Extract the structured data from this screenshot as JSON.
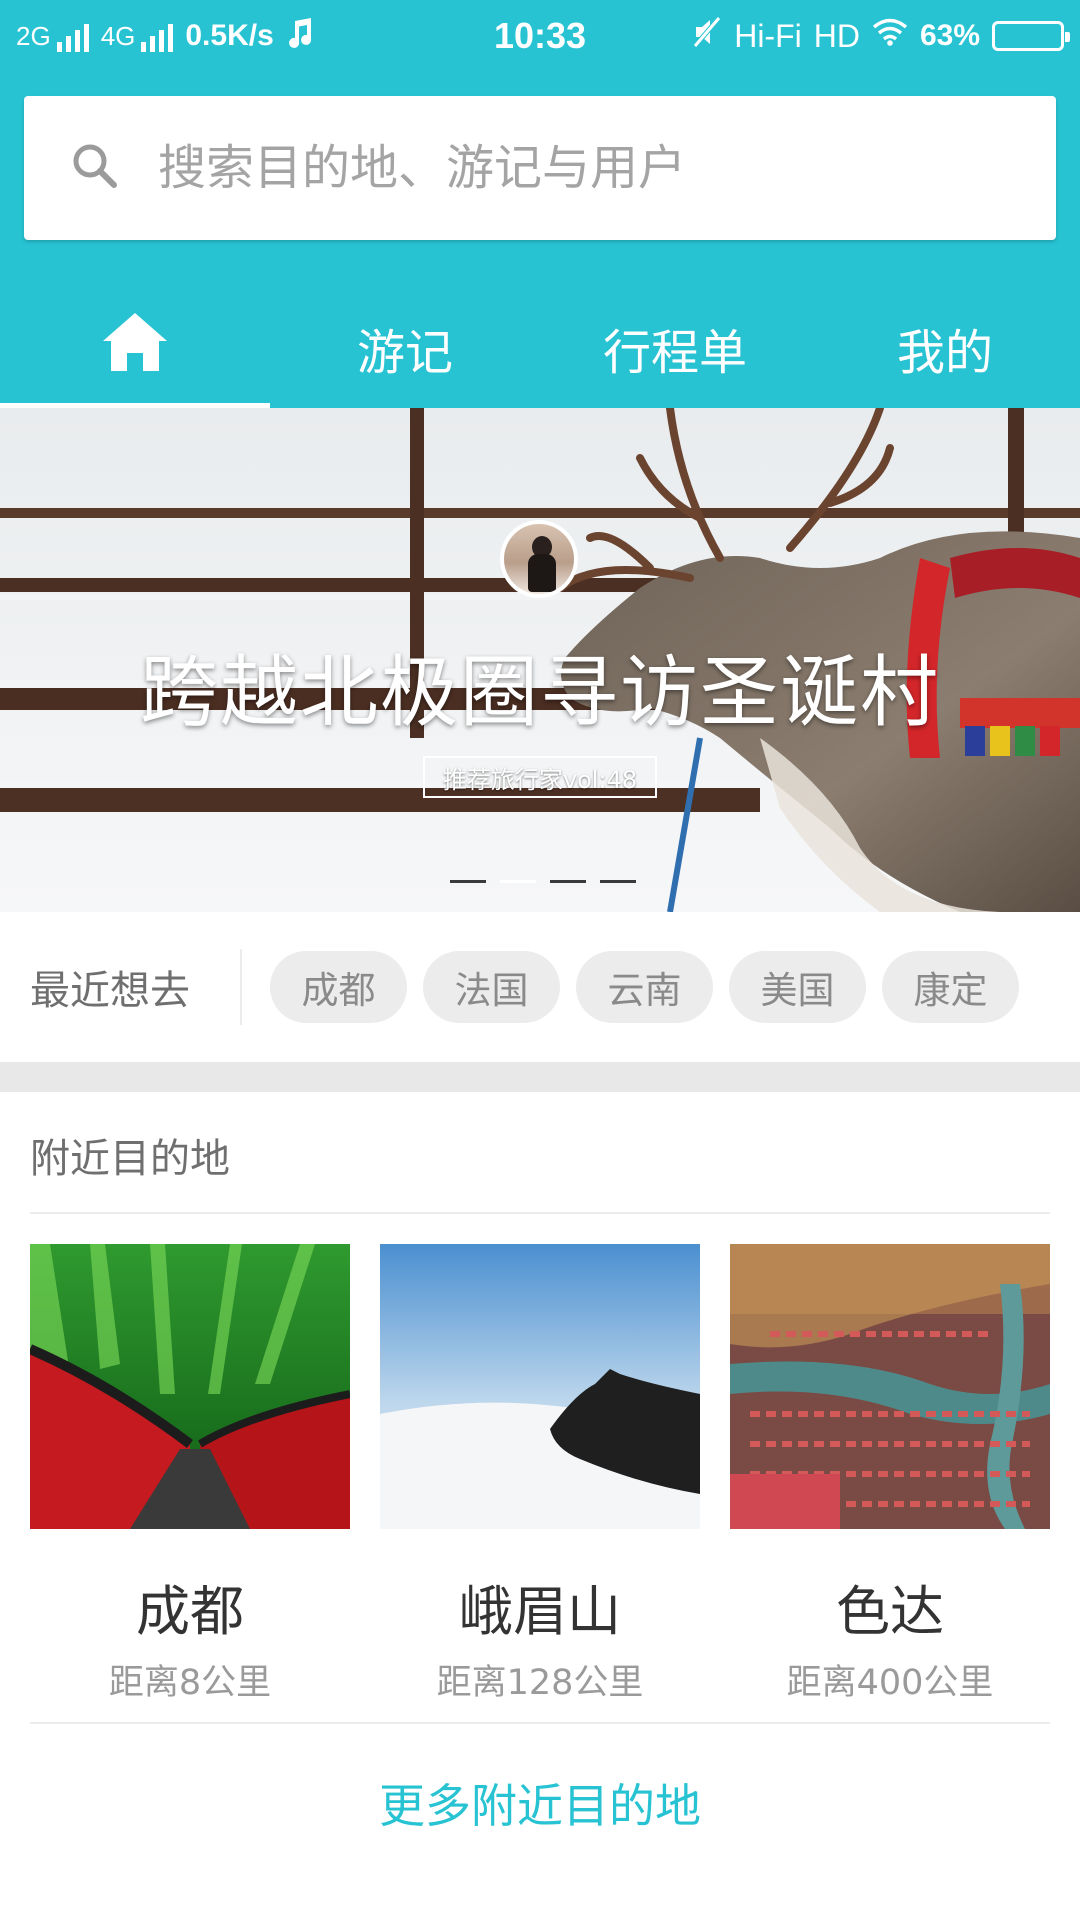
{
  "status_bar": {
    "network1": "2G",
    "network2": "4G",
    "speed": "0.5K/s",
    "time": "10:33",
    "hifi": "Hi-Fi",
    "hd": "HD",
    "battery_text": "63%",
    "battery_level": 0.63
  },
  "search": {
    "placeholder": "搜索目的地、游记与用户"
  },
  "tabs": {
    "home_icon": "home-icon",
    "travelogue": "游记",
    "itinerary": "行程单",
    "mine": "我的"
  },
  "hero": {
    "title": "跨越北极圈寻访圣诞村",
    "subtitle": "推荐旅行家vol:48",
    "page_count": 4,
    "active_page": 1
  },
  "recent": {
    "label": "最近想去",
    "chips": [
      "成都",
      "法国",
      "云南",
      "美国",
      "康定"
    ]
  },
  "nearby": {
    "title": "附近目的地",
    "items": [
      {
        "name": "成都",
        "distance": "距离8公里"
      },
      {
        "name": "峨眉山",
        "distance": "距离128公里"
      },
      {
        "name": "色达",
        "distance": "距离400公里"
      }
    ],
    "more": "更多附近目的地"
  },
  "colors": {
    "accent": "#27c3d3",
    "chip_bg": "#ececec"
  }
}
